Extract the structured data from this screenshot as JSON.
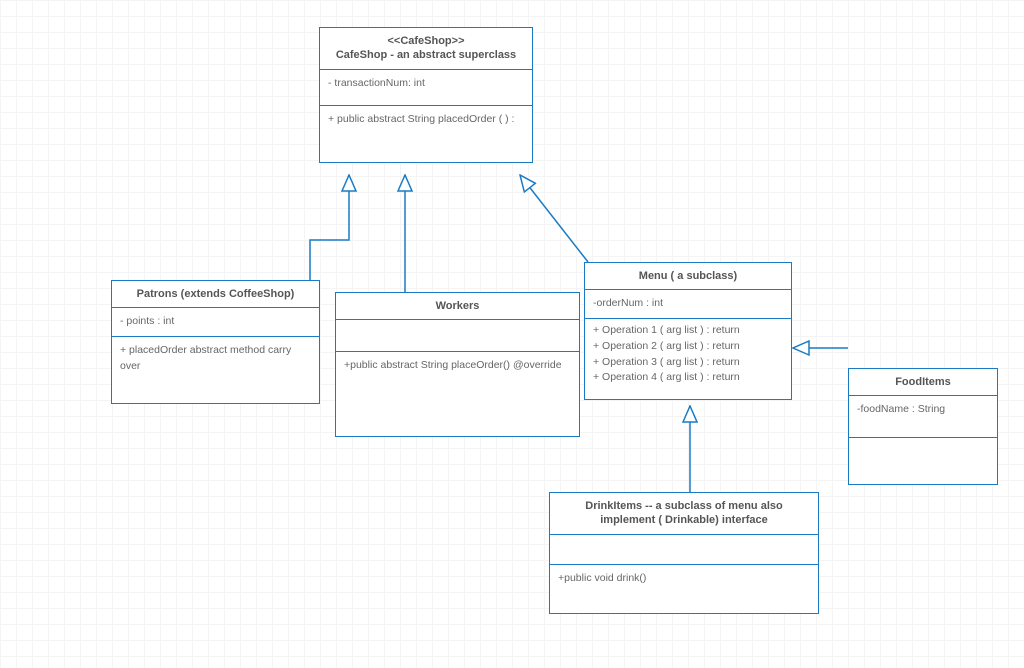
{
  "boxes": {
    "cafeshop": {
      "stereotype": "<<CafeShop>>",
      "title": "CafeShop - an abstract superclass",
      "attrs": "- transactionNum: int",
      "ops": "+ public abstract String placedOrder ( ) :"
    },
    "patrons": {
      "title": "Patrons (extends CoffeeShop)",
      "attrs": "- points : int",
      "ops": "+ placedOrder abstract method carry over"
    },
    "workers": {
      "title": "Workers",
      "attrs": "",
      "ops": "+public abstract String placeOrder() @override"
    },
    "menu": {
      "title": "Menu ( a subclass)",
      "attrs": "-orderNum : int",
      "op1": "+ Operation 1 ( arg list ) : return",
      "op2": "+ Operation 2 ( arg list ) : return",
      "op3": "+ Operation 3 ( arg list ) : return",
      "op4": "+ Operation 4 ( arg list ) : return"
    },
    "fooditems": {
      "title": "FoodItems",
      "attrs": "-foodName : String",
      "ops": ""
    },
    "drinkitems": {
      "title": "DrinkItems -- a subclass of menu also implement ( Drinkable) interface",
      "attrs": "",
      "ops": "+public void drink()"
    }
  }
}
